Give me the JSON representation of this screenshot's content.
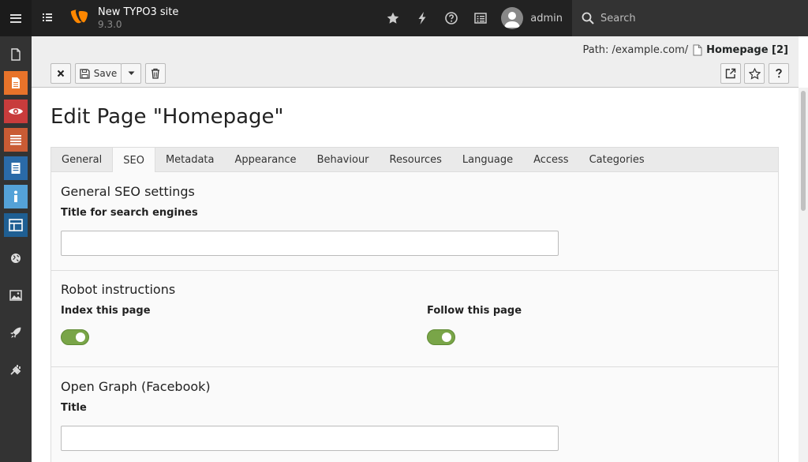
{
  "topbar": {
    "site_name": "New TYPO3 site",
    "site_version": "9.3.0",
    "username": "admin",
    "search_placeholder": "Search",
    "icons": [
      "menu-icon",
      "pagetree-toggle-icon",
      "typo3-logo",
      "bookmark-star-icon",
      "flash-cache-icon",
      "help-icon",
      "system-information-icon",
      "user-avatar-icon",
      "search-icon"
    ]
  },
  "modules": [
    {
      "name": "page-icon",
      "color": "#333333"
    },
    {
      "name": "page-module-icon",
      "color": "#e8732a"
    },
    {
      "name": "view-module-icon",
      "color": "#c83c3c"
    },
    {
      "name": "list-module-icon",
      "color": "#c95b34"
    },
    {
      "name": "form-module-icon",
      "color": "#2a6aa8"
    },
    {
      "name": "info-module-icon",
      "color": "#54a2d8"
    },
    {
      "name": "template-module-icon",
      "color": "#1f5f93"
    },
    {
      "name": "sites-icon",
      "color": "#333333"
    },
    {
      "name": "filelist-icon",
      "color": "#333333"
    },
    {
      "name": "extensions-rocket-icon",
      "color": "#333333"
    },
    {
      "name": "admin-tools-plug-icon",
      "color": "#333333"
    }
  ],
  "docheader": {
    "path_label": "Path: /example.com/",
    "page_title": "Homepage [2]",
    "save_label": "Save"
  },
  "main": {
    "title": "Edit Page \"Homepage\"",
    "tabs": [
      {
        "label": "General",
        "active": false
      },
      {
        "label": "SEO",
        "active": true
      },
      {
        "label": "Metadata",
        "active": false
      },
      {
        "label": "Appearance",
        "active": false
      },
      {
        "label": "Behaviour",
        "active": false
      },
      {
        "label": "Resources",
        "active": false
      },
      {
        "label": "Language",
        "active": false
      },
      {
        "label": "Access",
        "active": false
      },
      {
        "label": "Categories",
        "active": false
      }
    ],
    "sections": {
      "general_seo": {
        "heading": "General SEO settings",
        "title_label": "Title for search engines",
        "title_value": ""
      },
      "robots": {
        "heading": "Robot instructions",
        "index_label": "Index this page",
        "index_on": true,
        "follow_label": "Follow this page",
        "follow_on": true
      },
      "open_graph": {
        "heading": "Open Graph (Facebook)",
        "title_label": "Title",
        "title_value": ""
      }
    }
  },
  "colors": {
    "toggle_on": "#79a548",
    "topbar_bg": "#222222",
    "typo3_orange": "#ff8700"
  }
}
